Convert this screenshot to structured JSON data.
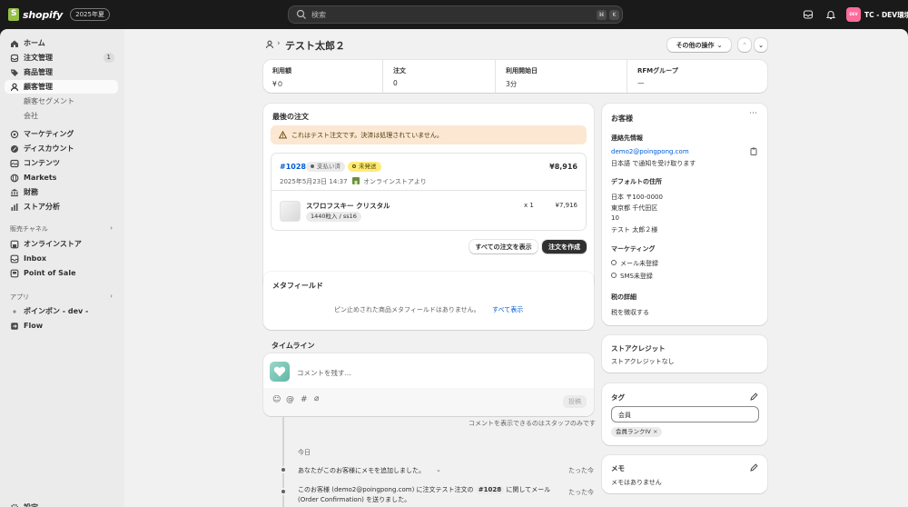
{
  "topbar": {
    "brand": "shopify",
    "edition": "2025年夏",
    "search_placeholder": "検索",
    "shortcut_keys": [
      "⌘",
      "K"
    ],
    "store_badge": "DEV",
    "store_name": "TC - DEV環境"
  },
  "sidebar": {
    "items": [
      {
        "label": "ホーム",
        "icon": "home-icon"
      },
      {
        "label": "注文管理",
        "icon": "orders-icon",
        "count": "1"
      },
      {
        "label": "商品管理",
        "icon": "tag-icon"
      },
      {
        "label": "顧客管理",
        "icon": "person-icon"
      },
      {
        "label": "顧客セグメント"
      },
      {
        "label": "会社"
      },
      {
        "label": "マーケティング",
        "icon": "target-icon"
      },
      {
        "label": "ディスカウント",
        "icon": "discount-icon"
      },
      {
        "label": "コンテンツ",
        "icon": "content-icon"
      },
      {
        "label": "Markets",
        "icon": "globe-icon"
      },
      {
        "label": "財務",
        "icon": "bank-icon"
      },
      {
        "label": "ストア分析",
        "icon": "chart-icon"
      }
    ],
    "sales_channels_label": "販売チャネル",
    "channels": [
      {
        "label": "オンラインストア",
        "icon": "store-icon"
      },
      {
        "label": "Inbox",
        "icon": "inbox-icon"
      },
      {
        "label": "Point of Sale",
        "icon": "pos-icon"
      }
    ],
    "apps_label": "アプリ",
    "apps": [
      {
        "label": "ポインポン - dev -",
        "icon": "app-dot-icon"
      },
      {
        "label": "Flow",
        "icon": "flow-icon"
      }
    ],
    "settings_label": "設定"
  },
  "header": {
    "title": "テスト太郎２",
    "more_actions": "その他の操作"
  },
  "stats": [
    {
      "label": "利用額",
      "value": "¥０"
    },
    {
      "label": "注文",
      "value": "0"
    },
    {
      "label": "利用開始日",
      "value": "3分"
    },
    {
      "label": "RFMグループ",
      "value": "—"
    }
  ],
  "last_order": {
    "title": "最後の注文",
    "notice": "これはテスト注文です。決済は処理されていません。",
    "order_number": "#1028",
    "payment_status": "支払い済",
    "fulfillment_status": "未発送",
    "total": "¥8,916",
    "date": "2025年5月23日 14:37",
    "source": "オンラインストアより",
    "item_name": "スワロフスキー クリスタル",
    "item_variant": "1440粒入 / ss16",
    "item_qty": "x 1",
    "item_price": "¥7,916",
    "view_all": "すべての注文を表示",
    "create_order": "注文を作成"
  },
  "metafields": {
    "title": "メタフィールド",
    "empty": "ピン止めされた商品メタフィールドはありません。",
    "show_all": "すべて表示"
  },
  "timeline": {
    "title": "タイムライン",
    "comment_placeholder": "コメントを残す...",
    "post": "投稿",
    "note": "コメントを表示できるのはスタッフのみです",
    "today": "今日",
    "events": [
      {
        "text": "あなたがこのお客様にメモを追加しました。",
        "time": "たった今"
      },
      {
        "text_pre": "このお客様 (demo2@poingpong.com) に注文テスト注文の",
        "order": "#1028",
        "text_post": "に関してメール",
        "text_line2": "(Order Confirmation) を送りました。",
        "time": "たった今"
      }
    ]
  },
  "customer": {
    "title": "お客様",
    "contact_title": "連絡先情報",
    "email": "demo2@poingpong.com",
    "lang_note": "日本語 で通知を受け取ります",
    "address_title": "デフォルトの住所",
    "address_lines": [
      "日本 〒100-0000",
      "東京都 千代田区",
      "10",
      "テスト 太郎２様"
    ],
    "marketing_title": "マーケティング",
    "marketing_email": "メール未登録",
    "marketing_sms": "SMS未登録",
    "tax_title": "税の詳細",
    "tax_value": "税を徴収する"
  },
  "store_credit": {
    "title": "ストアクレジット",
    "value": "ストアクレジットなし"
  },
  "tags": {
    "title": "タグ",
    "input_value": "会員",
    "chip": "会員ランクIV"
  },
  "memo": {
    "title": "メモ",
    "value": "メモはありません"
  }
}
